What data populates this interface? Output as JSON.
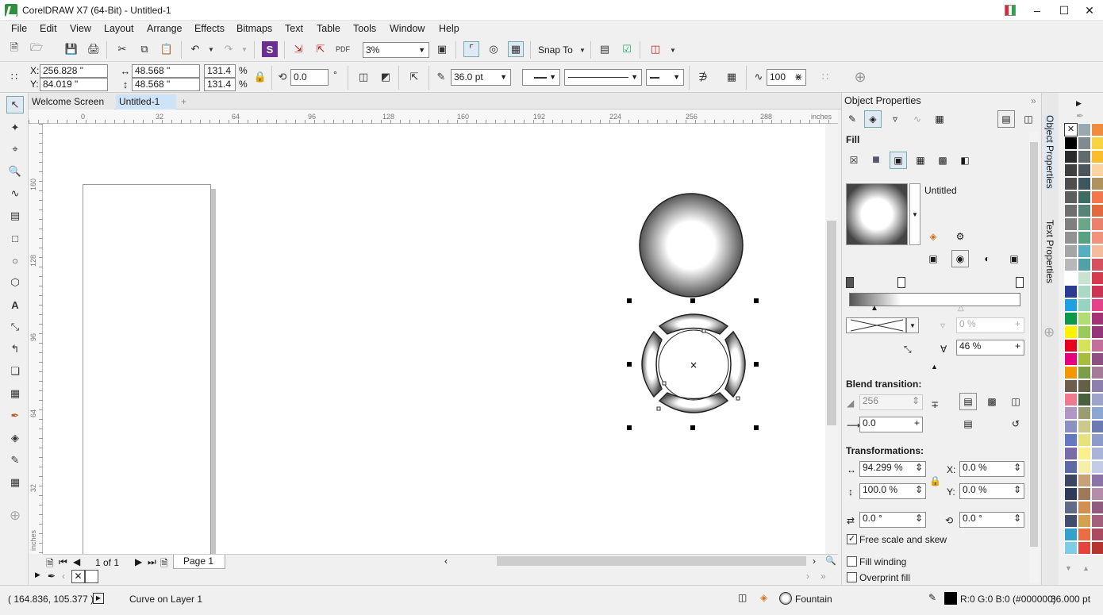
{
  "app": {
    "title": "CorelDRAW X7 (64-Bit) - Untitled-1"
  },
  "menu": [
    "File",
    "Edit",
    "View",
    "Layout",
    "Arrange",
    "Effects",
    "Bitmaps",
    "Text",
    "Table",
    "Tools",
    "Window",
    "Help"
  ],
  "standard_toolbar": {
    "zoom_level": "3%",
    "snap_to_label": "Snap To"
  },
  "property_bar": {
    "x_value": "256.828 \"",
    "y_value": "84.019 \"",
    "x_label": "X:",
    "y_label": "Y:",
    "width_value": "48.568 \"",
    "height_value": "48.568 \"",
    "scale_x": "131.4",
    "scale_y": "131.4",
    "percent": "%",
    "rotation_value": "0.0",
    "degree": "°",
    "outline_width": "36.0 pt",
    "nodes_value": "100"
  },
  "document_tabs": [
    {
      "label": "Welcome Screen",
      "active": false
    },
    {
      "label": "Untitled-1",
      "active": true
    }
  ],
  "ruler": {
    "h_ticks": [
      "0",
      "32",
      "64",
      "96",
      "128",
      "160",
      "192",
      "224",
      "256",
      "288"
    ],
    "v_ticks": [
      "160",
      "128",
      "96",
      "64",
      "32"
    ],
    "units": "inches"
  },
  "page_nav": {
    "page_counter": "1 of 1",
    "page_tab": "Page 1"
  },
  "docker": {
    "title": "Object Properties",
    "fill_section": "Fill",
    "fill_name": "Untitled",
    "transparency": "0 %",
    "midpoint": "46 %",
    "blend_transition": "Blend transition:",
    "steps": "256",
    "acceleration": "0.0",
    "transformations": "Transformations:",
    "tf_width": "94.299 %",
    "tf_height": "100.0 %",
    "tf_x": "0.0 %",
    "tf_y": "0.0 %",
    "tf_x_label": "X:",
    "tf_y_label": "Y:",
    "tf_skew": "0.0 °",
    "tf_rotate": "0.0 °",
    "free_scale_label": "Free scale and skew",
    "free_scale_checked": true,
    "fill_winding_label": "Fill winding",
    "overprint_fill_label": "Overprint fill"
  },
  "side_tabs": [
    "Object Properties",
    "Text Properties"
  ],
  "palette_colors": [
    [
      "#ffffff",
      "#9aa9b1",
      "#f08c3c"
    ],
    [
      "#000000",
      "#808a8f",
      "#f9d43f"
    ],
    [
      "#2a2a2a",
      "#626a6e",
      "#fbbd2b"
    ],
    [
      "#3f3f3f",
      "#4c5559",
      "#fcd4a2"
    ],
    [
      "#4e4e4e",
      "#3c5760",
      "#b0925d"
    ],
    [
      "#5e5e5e",
      "#3f6b63",
      "#f2784c"
    ],
    [
      "#6f6f6f",
      "#558478",
      "#e3693f"
    ],
    [
      "#7f7f7f",
      "#6aa788",
      "#ee7f6c"
    ],
    [
      "#929292",
      "#58a283",
      "#f2927c"
    ],
    [
      "#a5a5a5",
      "#54b0c0",
      "#f6ba9c"
    ],
    [
      "#b8b8b8",
      "#53a1a8",
      "#d65060"
    ],
    [
      "#ffffff",
      "#c9e3d2",
      "#d63a4f"
    ],
    [
      "#2c3c92",
      "#aad9c5",
      "#cc3355"
    ],
    [
      "#1ea1e0",
      "#96d4c1",
      "#e64189"
    ],
    [
      "#0c9a48",
      "#b0dd74",
      "#a53177"
    ],
    [
      "#fff200",
      "#99ca5a",
      "#97357a"
    ],
    [
      "#e6001b",
      "#d5e35b",
      "#c46e9c"
    ],
    [
      "#e5007d",
      "#a6bd3e",
      "#8e4f85"
    ],
    [
      "#f39800",
      "#7c9d4a",
      "#a47b9b"
    ],
    [
      "#6e5d4f",
      "#636045",
      "#8e7fae"
    ],
    [
      "#ed7a8f",
      "#4a5f3b",
      "#9ea3c9"
    ],
    [
      "#b296c4",
      "#9c9c72",
      "#8ea6d2"
    ],
    [
      "#8c91c4",
      "#cdc98d",
      "#6c7ab4"
    ],
    [
      "#6479bf",
      "#e8e27c",
      "#8d9bc9"
    ],
    [
      "#7a6ca7",
      "#fbf08c",
      "#a9b4d8"
    ],
    [
      "#5c6aa6",
      "#f6eea9",
      "#c4cbe6"
    ],
    [
      "#3c4663",
      "#c8a277",
      "#8a74a7"
    ],
    [
      "#2e3a5a",
      "#a0785b",
      "#b58dab"
    ],
    [
      "#5f6b88",
      "#d48d53",
      "#8f5b7e"
    ],
    [
      "#424c6d",
      "#d4a24c",
      "#a3607d"
    ],
    [
      "#34a0cc",
      "#ec6d43",
      "#aa4a63"
    ],
    [
      "#80cbe5",
      "#e4443c",
      "#b7332f"
    ]
  ],
  "status": {
    "coordinates": "( 164.836, 105.377 )",
    "object_info": "Curve on Layer 1",
    "fill_type": "Fountain",
    "outline_color": "R:0 G:0 B:0 (#000000)",
    "outline_width": "36.000 pt"
  }
}
